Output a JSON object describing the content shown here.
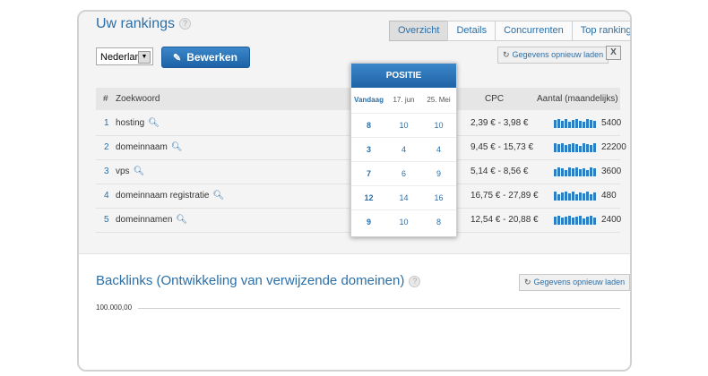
{
  "rankings": {
    "title": "Uw rankings",
    "tabs": [
      {
        "label": "Overzicht",
        "active": true
      },
      {
        "label": "Details",
        "active": false
      },
      {
        "label": "Concurrenten",
        "active": false
      },
      {
        "label": "Top rankings",
        "active": false
      }
    ],
    "country_select": "Nederland",
    "edit_button": "Bewerken",
    "reload_button": "Gegevens opnieuw laden",
    "columns": {
      "index": "#",
      "keyword": "Zoekwoord",
      "cpc": "CPC",
      "volume": "Aantal (maandelijks)"
    },
    "rows": [
      {
        "index": "1",
        "keyword": "hosting",
        "cpc": "2,39 € - 3,98 €",
        "volume": "5400",
        "trend": [
          0.8,
          0.9,
          0.7,
          0.9,
          0.6,
          0.8,
          0.9,
          0.7,
          0.6,
          0.9,
          0.8,
          0.7
        ]
      },
      {
        "index": "2",
        "keyword": "domeinnaam",
        "cpc": "9,45 € - 15,73 €",
        "volume": "22200",
        "trend": [
          0.9,
          0.8,
          0.9,
          0.7,
          0.8,
          0.9,
          0.8,
          0.6,
          0.9,
          0.8,
          0.7,
          0.9
        ]
      },
      {
        "index": "3",
        "keyword": "vps",
        "cpc": "5,14 € - 8,56 €",
        "volume": "3600",
        "trend": [
          0.7,
          0.9,
          0.8,
          0.6,
          0.9,
          0.8,
          0.9,
          0.7,
          0.8,
          0.6,
          0.9,
          0.8
        ]
      },
      {
        "index": "4",
        "keyword": "domeinnaam registratie",
        "cpc": "16,75 € - 27,89 €",
        "volume": "480",
        "trend": [
          0.9,
          0.6,
          0.8,
          0.9,
          0.7,
          0.9,
          0.6,
          0.8,
          0.7,
          0.9,
          0.6,
          0.8
        ]
      },
      {
        "index": "5",
        "keyword": "domeinnamen",
        "cpc": "12,54 € - 20,88 €",
        "volume": "2400",
        "trend": [
          0.8,
          0.9,
          0.7,
          0.8,
          0.9,
          0.7,
          0.8,
          0.9,
          0.6,
          0.8,
          0.9,
          0.7
        ]
      }
    ]
  },
  "position_popup": {
    "title": "POSITIE",
    "columns": [
      "Vandaag",
      "17. jun",
      "25. Mei"
    ],
    "rows": [
      [
        "8",
        "10",
        "10"
      ],
      [
        "3",
        "4",
        "4"
      ],
      [
        "7",
        "6",
        "9"
      ],
      [
        "12",
        "14",
        "16"
      ],
      [
        "9",
        "10",
        "8"
      ]
    ]
  },
  "backlinks": {
    "title": "Backlinks (Ontwikkeling van verwijzende domeinen)",
    "reload_button": "Gegevens opnieuw laden",
    "axis_label": "100.000,00"
  },
  "colors": {
    "accent": "#2a6fa8",
    "button": "#1f63a6",
    "spark": "#2b7fc2"
  },
  "icons": {
    "help": "help-icon",
    "edit": "pencil-icon",
    "reload": "refresh-icon",
    "export": "excel-icon",
    "search": "magnifier-icon"
  }
}
